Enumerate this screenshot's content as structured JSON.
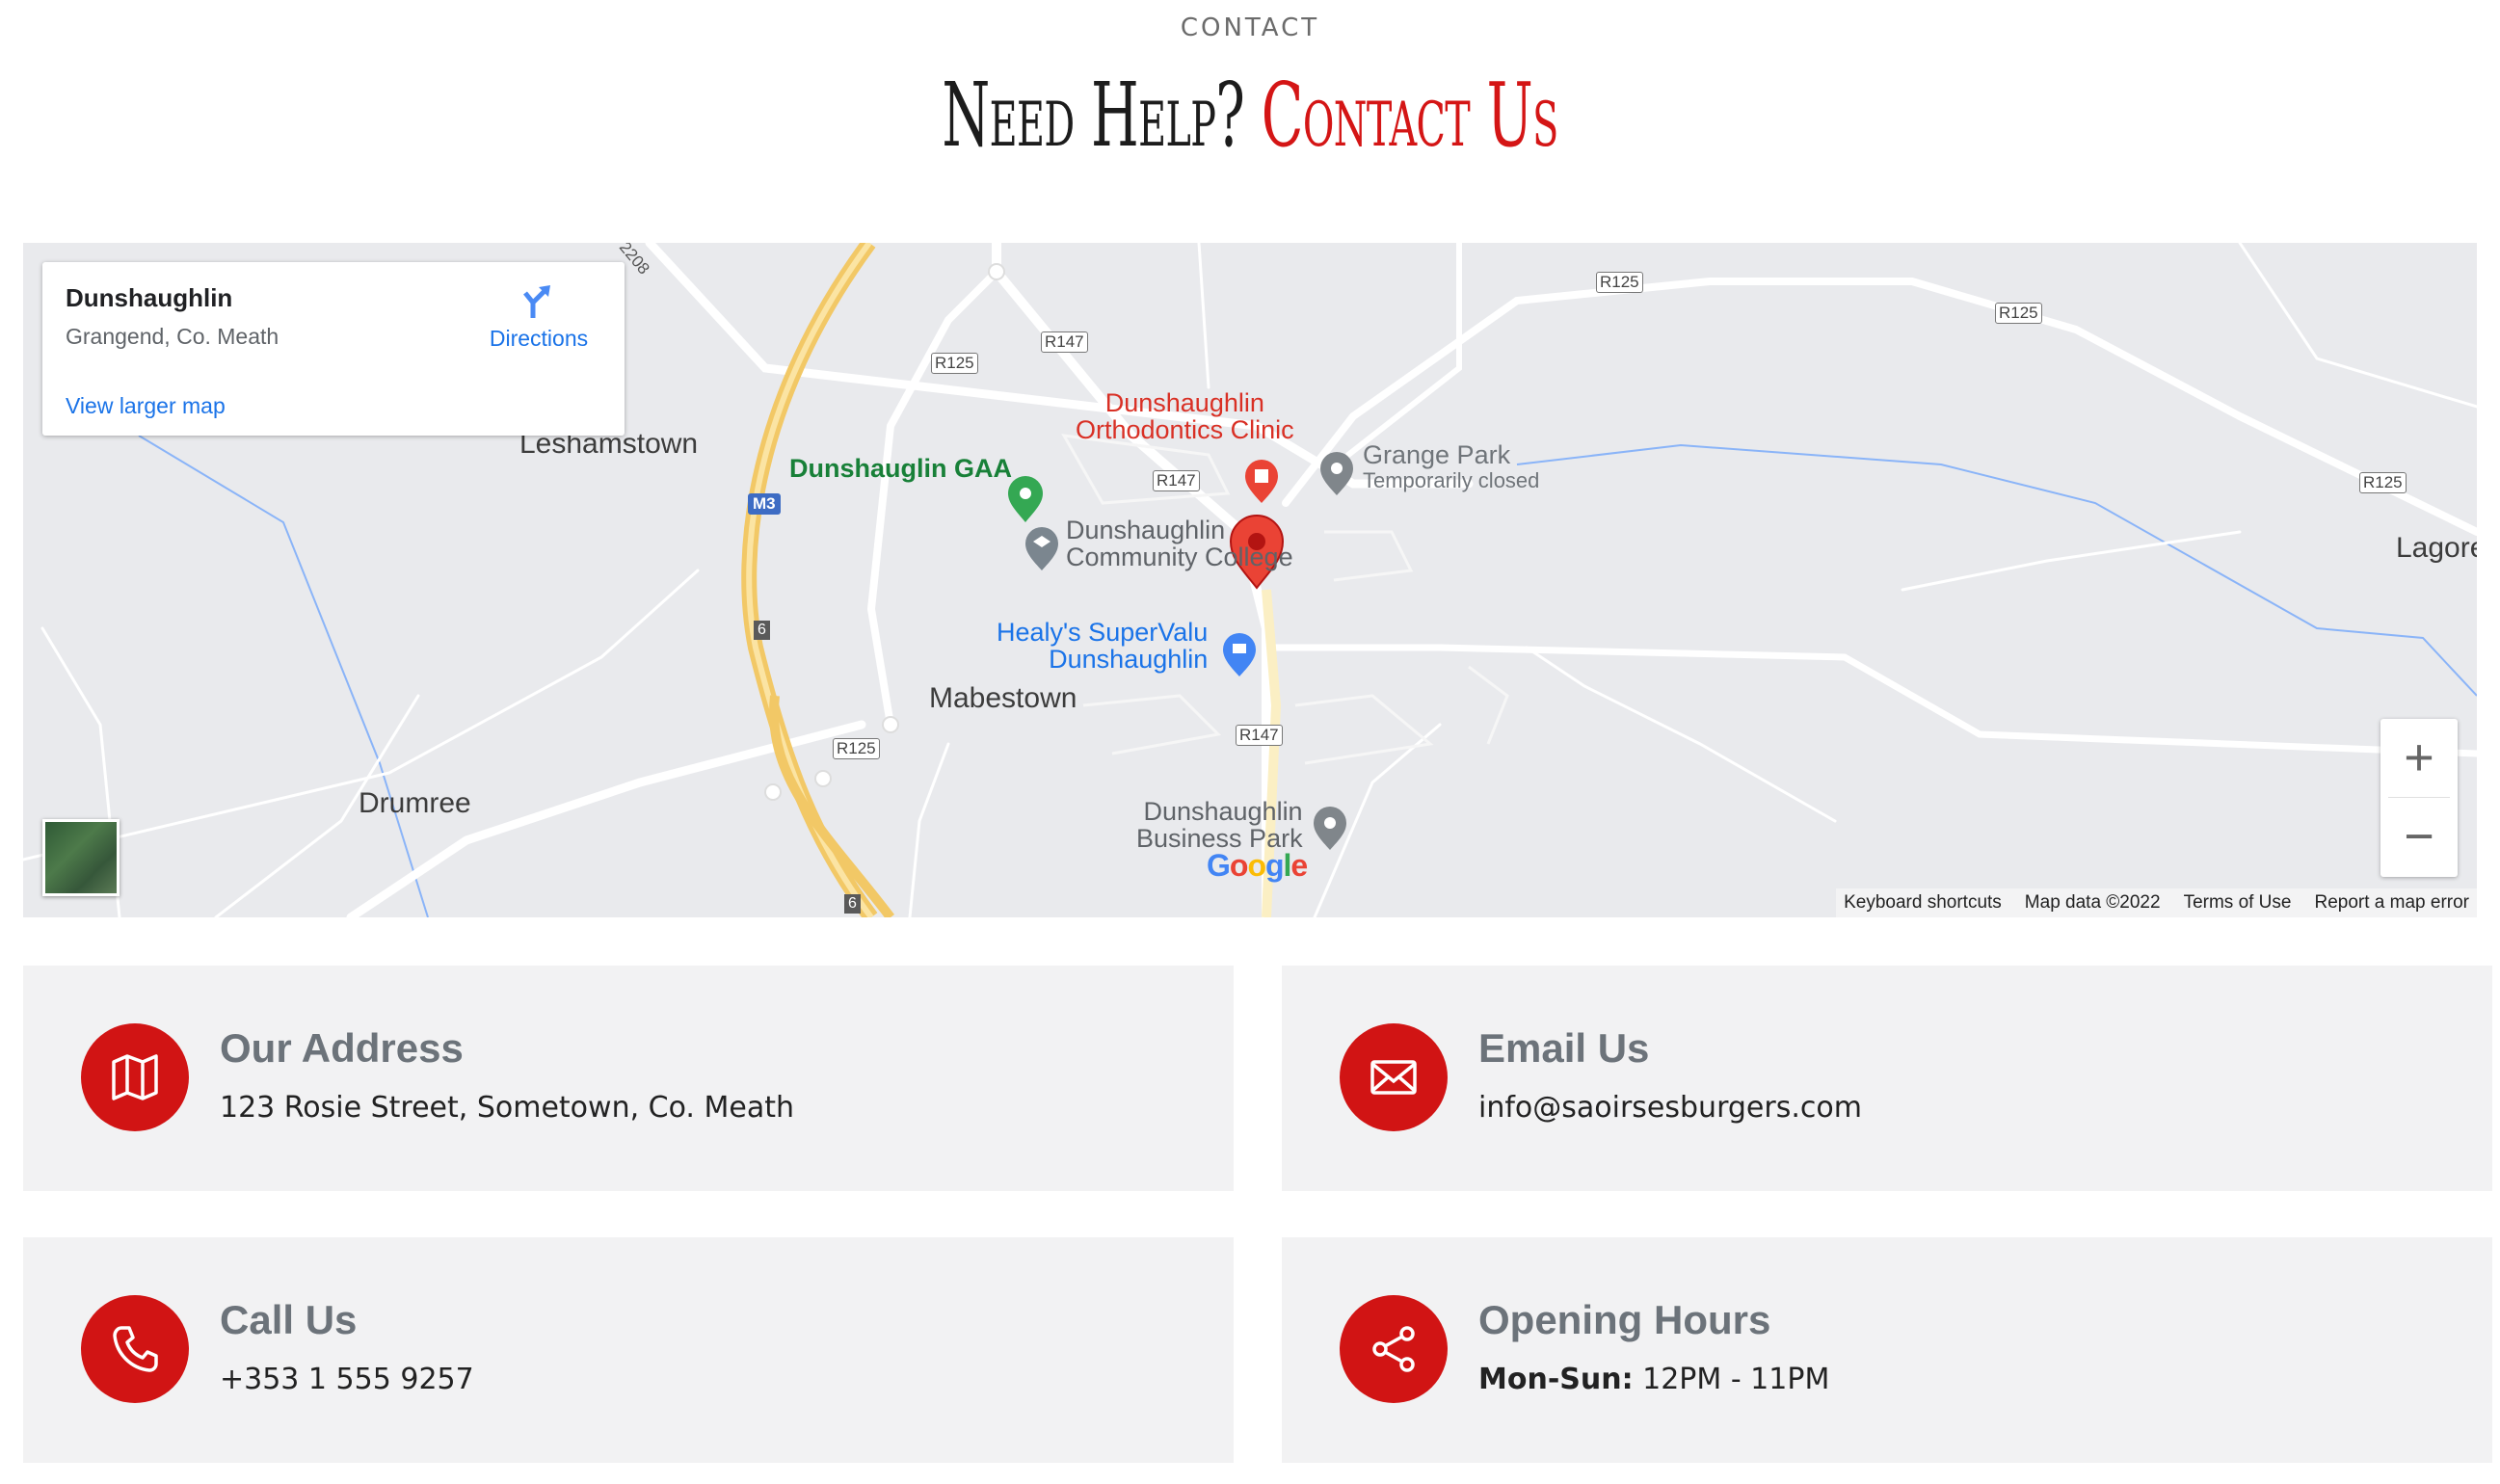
{
  "section": {
    "eyebrow": "CONTACT",
    "title_part1": "Need Help?",
    "title_part2": "Contact Us"
  },
  "colors": {
    "accent": "#d11414",
    "card_bg": "#f2f2f3",
    "link": "#1a73e8"
  },
  "map": {
    "place_card": {
      "name": "Dunshaughlin",
      "address": "Grangend, Co. Meath",
      "directions_label": "Directions",
      "larger_map_label": "View larger map"
    },
    "labels": {
      "leshamstown": "Leshamstown",
      "mabestown": "Mabestown",
      "drumree": "Drumree",
      "lagore": "Lagore",
      "gaa": "Dunshauglin GAA",
      "ortho_1": "Dunshaughlin",
      "ortho_2": "Orthodontics Clinic",
      "grange": "Grange Park",
      "grange_status": "Temporarily closed",
      "college_1": "Dunshaughlin",
      "college_2": "Community College",
      "supervalu_1": "Healy's SuperValu",
      "supervalu_2": "Dunshaughlin",
      "business_1": "Dunshaughlin",
      "business_2": "Business Park"
    },
    "road_shields": {
      "r125": "R125",
      "r147": "R147",
      "m3": "M3",
      "n6": "6",
      "r208": "2208"
    },
    "zoom_in": "+",
    "zoom_out": "−",
    "google_logo": "Google",
    "attribution": {
      "keyboard": "Keyboard shortcuts",
      "data": "Map data ©2022",
      "terms": "Terms of Use",
      "report": "Report a map error"
    }
  },
  "cards": {
    "address": {
      "title": "Our Address",
      "text": "123 Rosie Street, Sometown, Co. Meath",
      "icon": "map-icon"
    },
    "email": {
      "title": "Email Us",
      "text": "info@saoirsesburgers.com",
      "icon": "envelope-icon"
    },
    "call": {
      "title": "Call Us",
      "text": "+353 1 555 9257",
      "icon": "phone-icon"
    },
    "hours": {
      "title": "Opening Hours",
      "label": "Mon-Sun:",
      "text": " 12PM - 11PM",
      "icon": "share-icon"
    }
  }
}
